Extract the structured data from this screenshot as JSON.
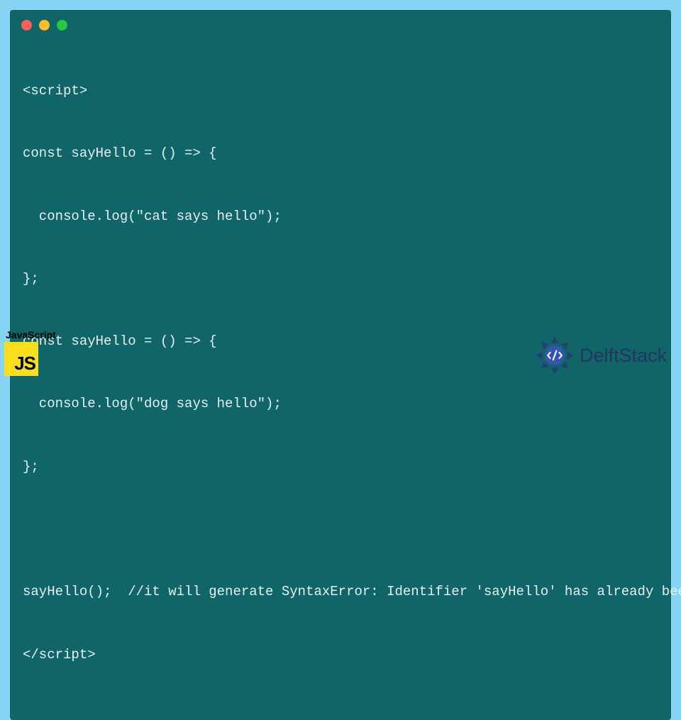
{
  "code": {
    "lines": [
      "<script>",
      "const sayHello = () => {",
      "  console.log(\"cat says hello\");",
      "};",
      "const sayHello = () => {",
      "  console.log(\"dog says hello\");",
      "};",
      "",
      "sayHello();  //it will generate SyntaxError: Identifier 'sayHello' has already been declared",
      "</script>"
    ]
  },
  "footer": {
    "js_label": "JavaScript",
    "js_logo_text": "JS",
    "brand_text": "DelftStack"
  },
  "colors": {
    "page_bg": "#87d5f2",
    "window_bg": "#0f6567",
    "code_fg": "#e8f3f3",
    "js_yellow": "#f7df1e",
    "brand_color": "#25355f"
  }
}
